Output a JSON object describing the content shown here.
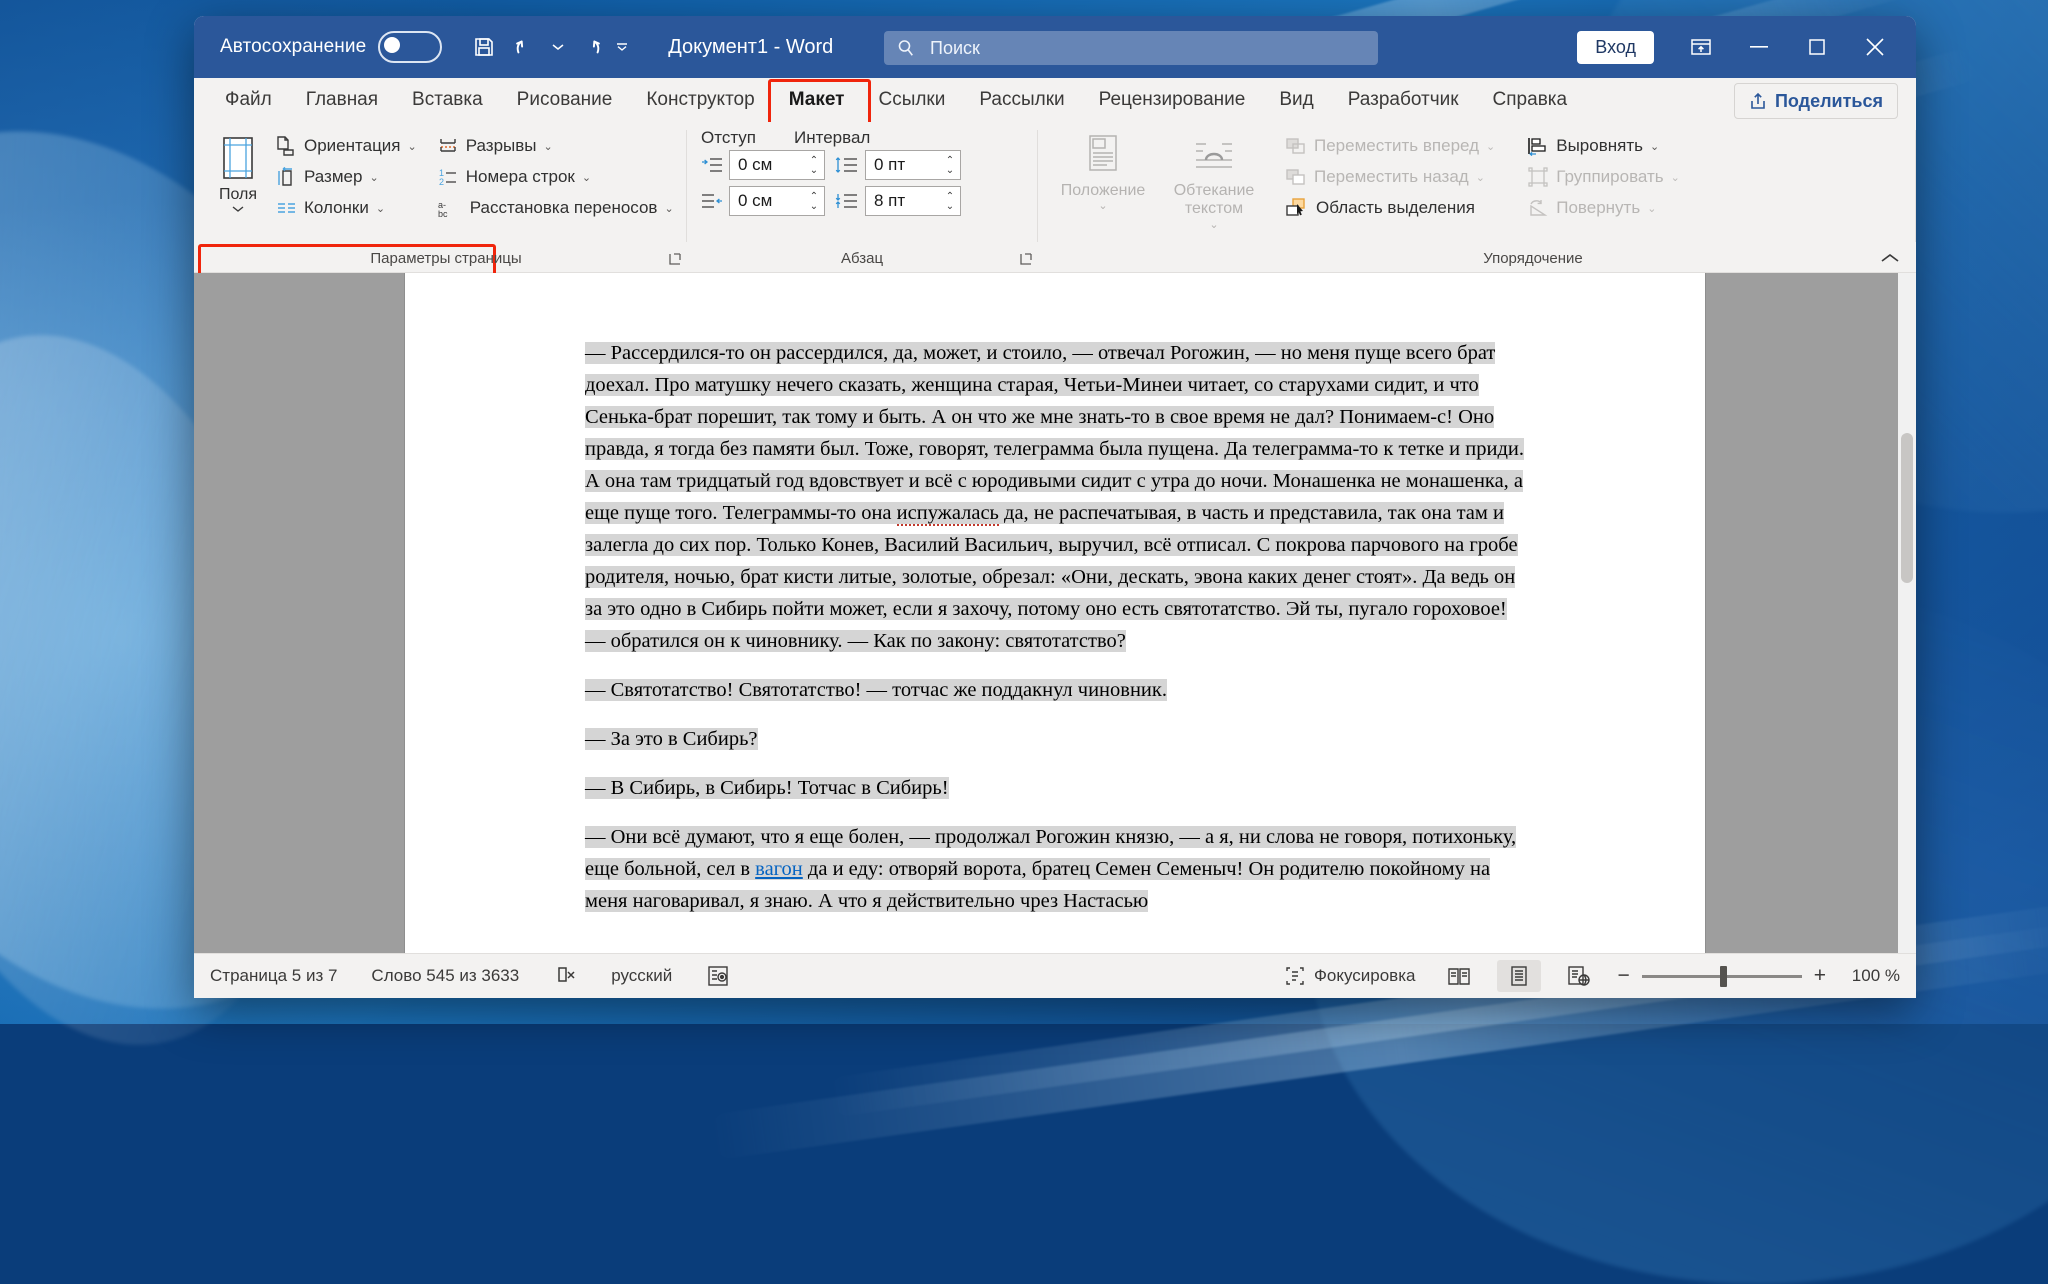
{
  "titlebar": {
    "autosave_label": "Автосохранение",
    "autosave_state": "off",
    "save_icon": "save-icon",
    "undo_icon": "undo-icon",
    "redo_icon": "redo-icon",
    "customize_icon": "customize-quick-access-icon",
    "document_title": "Документ1  -  Word",
    "search_placeholder": "Поиск",
    "search_icon": "search-icon",
    "signin_label": "Вход",
    "restore_updown_icon": "ribbon-display-options-icon",
    "minimize_icon": "minimize-icon",
    "maximize_icon": "maximize-icon",
    "close_icon": "close-icon"
  },
  "tabs": [
    {
      "label": "Файл",
      "active": false
    },
    {
      "label": "Главная",
      "active": false
    },
    {
      "label": "Вставка",
      "active": false
    },
    {
      "label": "Рисование",
      "active": false
    },
    {
      "label": "Конструктор",
      "active": false
    },
    {
      "label": "Макет",
      "active": true
    },
    {
      "label": "Ссылки",
      "active": false
    },
    {
      "label": "Рассылки",
      "active": false
    },
    {
      "label": "Рецензирование",
      "active": false
    },
    {
      "label": "Вид",
      "active": false
    },
    {
      "label": "Разработчик",
      "active": false
    },
    {
      "label": "Справка",
      "active": false
    }
  ],
  "share": {
    "label": "Поделиться",
    "icon": "share-icon"
  },
  "ribbon": {
    "collapse_icon": "collapse-ribbon-chevron-icon",
    "highlight_color": "#f0250c",
    "groups": [
      {
        "name": "Параметры страницы",
        "label": "Параметры страницы",
        "has_dialog_launcher": true,
        "highlighted": true,
        "big_buttons": [
          {
            "label": "Поля",
            "icon": "margins-icon",
            "has_dropdown": true,
            "disabled": false
          }
        ],
        "small_buttons": [
          {
            "label": "Ориентация",
            "icon": "orientation-icon",
            "has_dropdown": true,
            "disabled": false
          },
          {
            "label": "Размер",
            "icon": "size-icon",
            "has_dropdown": true,
            "disabled": false
          },
          {
            "label": "Колонки",
            "icon": "columns-icon",
            "has_dropdown": true,
            "disabled": false
          },
          {
            "label": "Разрывы",
            "icon": "breaks-icon",
            "has_dropdown": true,
            "disabled": false
          },
          {
            "label": "Номера строк",
            "icon": "line-numbers-icon",
            "has_dropdown": true,
            "disabled": false
          },
          {
            "label": "Расстановка переносов",
            "icon": "hyphenation-icon",
            "has_dropdown": true,
            "disabled": false
          }
        ]
      },
      {
        "name": "Абзац",
        "label": "Абзац",
        "has_dialog_launcher": true,
        "highlighted": false,
        "headers": [
          "Отступ",
          "Интервал"
        ],
        "spinners": [
          {
            "name": "indent-left",
            "icon": "indent-left-icon",
            "value": "0 см"
          },
          {
            "name": "spacing-before",
            "icon": "spacing-before-icon",
            "value": "0 пт"
          },
          {
            "name": "indent-right",
            "icon": "indent-right-icon",
            "value": "0 см"
          },
          {
            "name": "spacing-after",
            "icon": "spacing-after-icon",
            "value": "8 пт"
          }
        ]
      },
      {
        "name": "Упорядочение",
        "label": "Упорядочение",
        "has_dialog_launcher": false,
        "highlighted": false,
        "big_buttons": [
          {
            "label": "Положение",
            "icon": "position-icon",
            "has_dropdown": true,
            "disabled": true
          },
          {
            "label": "Обтекание текстом",
            "icon": "wrap-text-icon",
            "has_dropdown": true,
            "disabled": true
          }
        ],
        "small_buttons": [
          {
            "label": "Переместить вперед",
            "icon": "bring-forward-icon",
            "has_dropdown": true,
            "disabled": true
          },
          {
            "label": "Переместить назад",
            "icon": "send-backward-icon",
            "has_dropdown": true,
            "disabled": true
          },
          {
            "label": "Область выделения",
            "icon": "selection-pane-icon",
            "has_dropdown": false,
            "disabled": false
          },
          {
            "label": "Выровнять",
            "icon": "align-icon",
            "has_dropdown": true,
            "disabled": false
          },
          {
            "label": "Группировать",
            "icon": "group-icon",
            "has_dropdown": true,
            "disabled": true
          },
          {
            "label": "Повернуть",
            "icon": "rotate-icon",
            "has_dropdown": true,
            "disabled": true
          }
        ]
      }
    ]
  },
  "document": {
    "paragraphs": [
      {
        "selected": true,
        "text": "— Рассердился-то он рассердился, да, может, и стоило, — отвечал Рогожин, — но меня пуще всего брат доехал. Про матушку нечего сказать, женщина старая, Четьи-Минеи читает, со старухами сидит, и что Сенька-брат порешит, так тому и быть. А он что же мне знать-то в свое время не дал? Понимаем-с! Оно правда, я тогда без памяти был. Тоже, говорят, телеграмма была пущена. Да телеграмма-то к тетке и приди. А она там тридцатый год вдовствует и всё с юродивыми сидит с утра до ночи. Монашенка не монашенка, а еще пуще того. Телеграммы-то она испужалась да, не распечатывая, в часть и представила, так она там и залегла до сих пор. Только Конев, Василий Васильич, выручил, всё отписал. С покрова парчового на гробе родителя, ночью, брат кисти литые, золотые, обрезал: «Они, дескать, эвона каких денег стоят». Да ведь он за это одно в Сибирь пойти может, если я захочу, потому оно есть святотатство. Эй ты, пугало гороховое! — обратился он к чиновнику. — Как по закону: святотатство?"
      },
      {
        "selected": true,
        "text": "— Святотатство! Святотатство! — тотчас же поддакнул чиновник."
      },
      {
        "selected": true,
        "text": "— За это в Сибирь?"
      },
      {
        "selected": true,
        "text": "— В Сибирь, в Сибирь! Тотчас в Сибирь!"
      },
      {
        "selected": true,
        "text": "— Они всё думают, что я еще болен, — продолжал Рогожин князю, — а я, ни слова не говоря, потихоньку, еще больной, сел в вагон да и еду: отворяй ворота, братец Семен Семеныч! Он родителю покойному на меня наговаривал, я знаю. А что я действительно чрез Настасью"
      }
    ],
    "spell_error_word": "испужалась",
    "link_word": "вагон"
  },
  "statusbar": {
    "page_info": "Страница 5 из 7",
    "word_count": "Слово 545 из 3633",
    "proofing_icon": "proofing-errors-icon",
    "language": "русский",
    "accessibility_icon": "accessibility-icon",
    "focus_label": "Фокусировка",
    "focus_icon": "focus-icon",
    "view_read_icon": "read-mode-icon",
    "view_print_icon": "print-layout-icon",
    "view_web_icon": "web-layout-icon",
    "zoom_out_label": "−",
    "zoom_in_label": "+",
    "zoom_level": "100 %"
  }
}
